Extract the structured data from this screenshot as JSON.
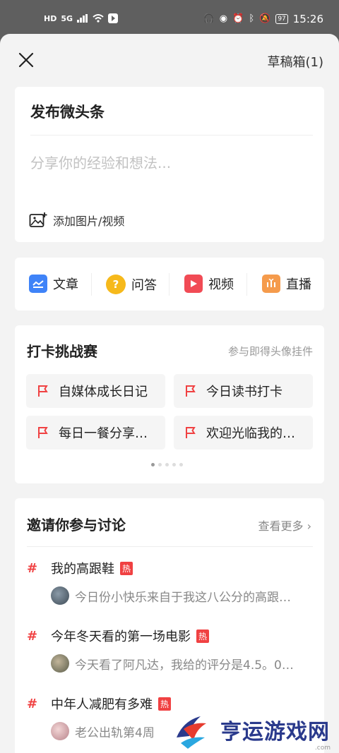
{
  "status_bar": {
    "left_tags": [
      "HD",
      "5G"
    ],
    "battery": "97",
    "time": "15:26"
  },
  "header": {
    "drafts_label": "草稿箱(1)"
  },
  "compose": {
    "title": "发布微头条",
    "placeholder": "分享你的经验和想法...",
    "add_media_label": "添加图片/视频"
  },
  "post_types": [
    {
      "label": "文章",
      "icon": "article-icon",
      "color": "#3f83f8"
    },
    {
      "label": "问答",
      "icon": "qa-icon",
      "color": "#f6b91b"
    },
    {
      "label": "视频",
      "icon": "video-icon",
      "color": "#f14b55"
    },
    {
      "label": "直播",
      "icon": "live-icon",
      "color": "#f59b4c"
    }
  ],
  "challenge": {
    "title": "打卡挑战赛",
    "hint": "参与即得头像挂件",
    "items": [
      "自媒体成长日记",
      "今日读书打卡",
      "每日一餐分享…",
      "欢迎光临我的…"
    ]
  },
  "discussion": {
    "title": "邀请你参与讨论",
    "more_label": "查看更多",
    "topics": [
      {
        "name": "我的高跟鞋",
        "badge": "热",
        "snippet": "今日份小快乐来自于我这八公分的高跟…"
      },
      {
        "name": "今年冬天看的第一场电影",
        "badge": "热",
        "snippet": "今天看了阿凡达，我给的评分是4.5。0…"
      },
      {
        "name": "中年人减肥有多难",
        "badge": "热",
        "snippet": "老公出轨第4周"
      }
    ]
  },
  "watermark": {
    "text": "亨运游戏网",
    "sub": ".com"
  }
}
